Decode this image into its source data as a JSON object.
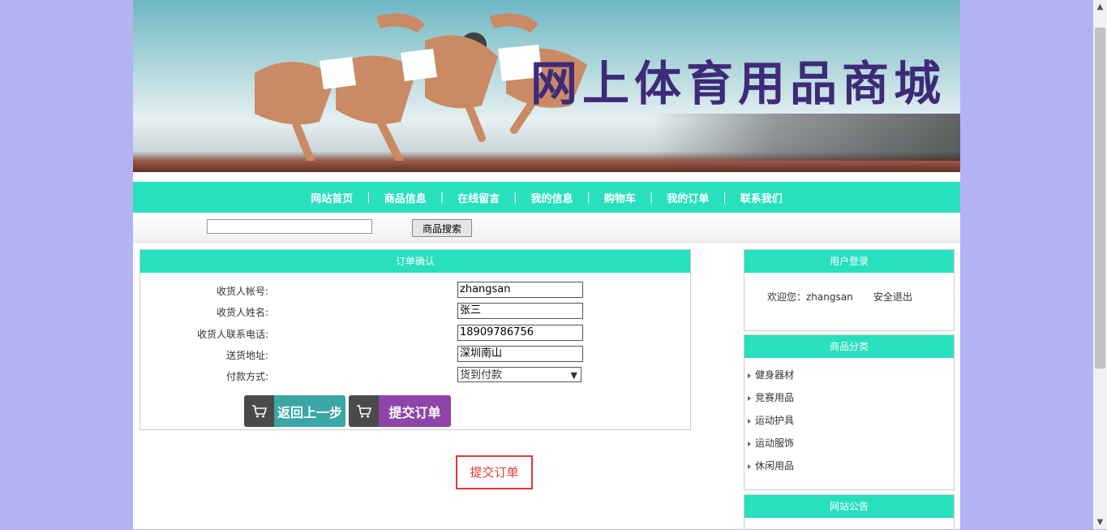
{
  "banner": {
    "title": "网上体育用品商城"
  },
  "nav": {
    "items": [
      "网站首页",
      "商品信息",
      "在线留言",
      "我的信息",
      "购物车",
      "我的订单",
      "联系我们"
    ],
    "separator": "|"
  },
  "search": {
    "value": "",
    "button": "商品搜索"
  },
  "order": {
    "title": "订单确认",
    "fields": [
      {
        "label": "收货人帐号:",
        "value": "zhangsan"
      },
      {
        "label": "收货人姓名:",
        "value": "张三"
      },
      {
        "label": "收货人联系电话:",
        "value": "18909786756"
      },
      {
        "label": "送货地址:",
        "value": "深圳南山"
      }
    ],
    "payment": {
      "label": "付款方式:",
      "selected": "货到付款"
    },
    "back_button": "返回上一步",
    "submit_button": "提交订单",
    "submit_highlight": "提交订单"
  },
  "login": {
    "title": "用户登录",
    "welcome": "欢迎您：zhangsan",
    "logout": "安全退出"
  },
  "categories": {
    "title": "商品分类",
    "items": [
      "健身器材",
      "竞赛用品",
      "运动护具",
      "运动服饰",
      "休闲用品"
    ]
  },
  "notice": {
    "title": "网站公告"
  },
  "colors": {
    "accent": "#28e0bd",
    "background": "#b3b3f2",
    "back_button": "#3aa6a6",
    "submit_button": "#8e44a8",
    "highlight": "#e03a3a"
  }
}
